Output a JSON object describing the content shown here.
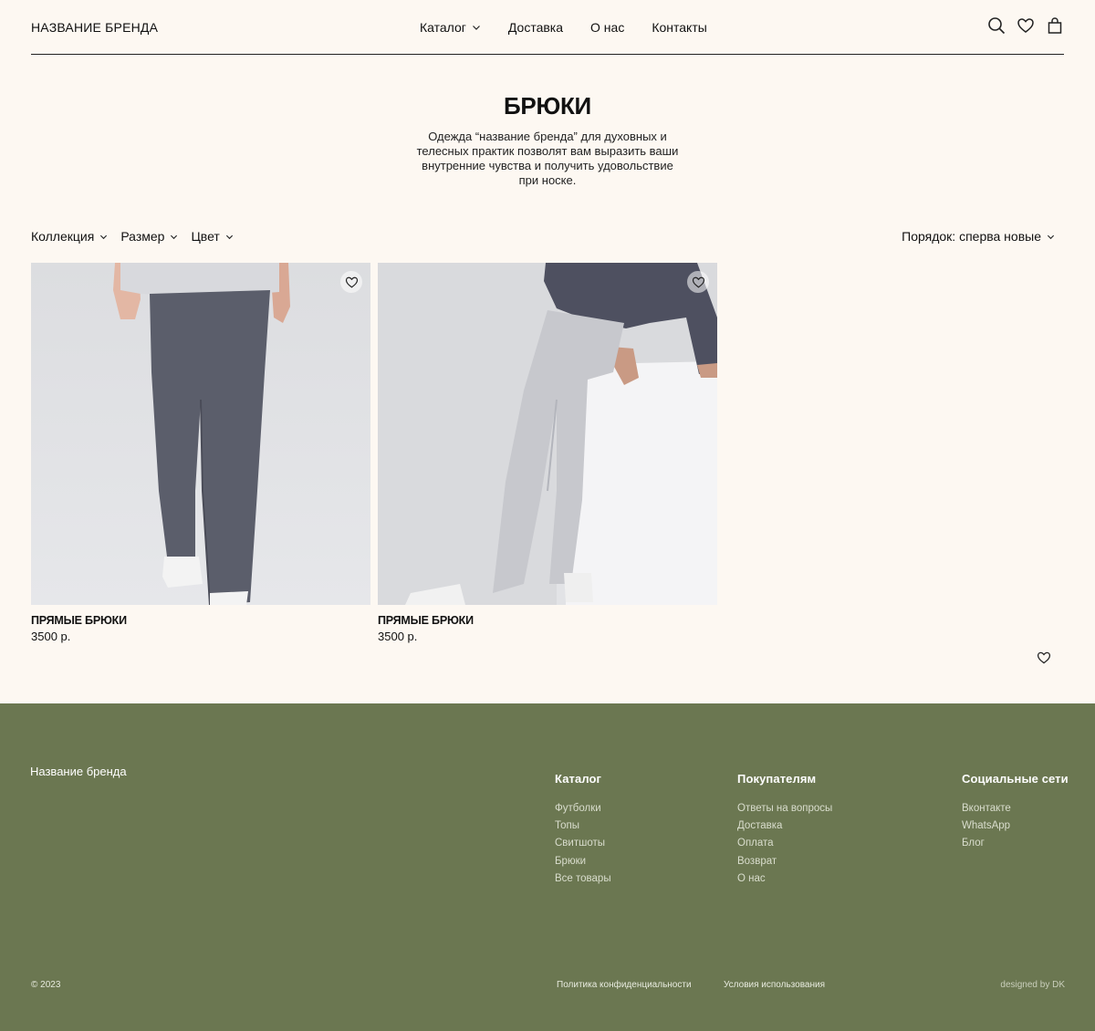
{
  "header": {
    "brand": "НАЗВАНИЕ БРЕНДА",
    "nav": [
      {
        "label": "Каталог",
        "dropdown": true
      },
      {
        "label": "Доставка",
        "dropdown": false
      },
      {
        "label": "О нас",
        "dropdown": false
      },
      {
        "label": "Контакты",
        "dropdown": false
      }
    ],
    "icons": [
      "search-icon",
      "heart-icon",
      "bag-icon"
    ]
  },
  "main": {
    "title": "БРЮКИ",
    "description": "Одежда “название бренда” для духовных и телесных практик позволят вам выразить ваши внутренние чувства и получить удовольствие при носке.",
    "filters": [
      "Коллекция",
      "Размер",
      "Цвет"
    ],
    "sort": "Порядок: сперва новые",
    "products": [
      {
        "name": "ПРЯМЫЕ БРЮКИ",
        "price": "3500 р.",
        "pants_color": "#5b5e6b"
      },
      {
        "name": "ПРЯМЫЕ БРЮКИ",
        "price": "3500 р.",
        "pants_color": "#c7c8cd"
      }
    ]
  },
  "footer": {
    "brand": "Название бренда",
    "columns": [
      {
        "title": "Каталог",
        "links": [
          "Футболки",
          "Топы",
          "Свитшоты",
          "Брюки",
          "Все товары"
        ]
      },
      {
        "title": "Покупателям",
        "links": [
          "Ответы на вопросы",
          "Доставка",
          "Оплата",
          "Возврат",
          "О нас"
        ]
      },
      {
        "title": "Социальные сети",
        "links": [
          "Вконтакте",
          "WhatsApp",
          "Блог"
        ]
      }
    ],
    "copyright": "© 2023",
    "privacy": "Политика конфиденциальности",
    "terms": "Условия использования",
    "credit": "designed by DK",
    "bg_color": "#6b7751"
  },
  "colors": {
    "page_bg": "#fdf8f2",
    "text": "#111111"
  }
}
